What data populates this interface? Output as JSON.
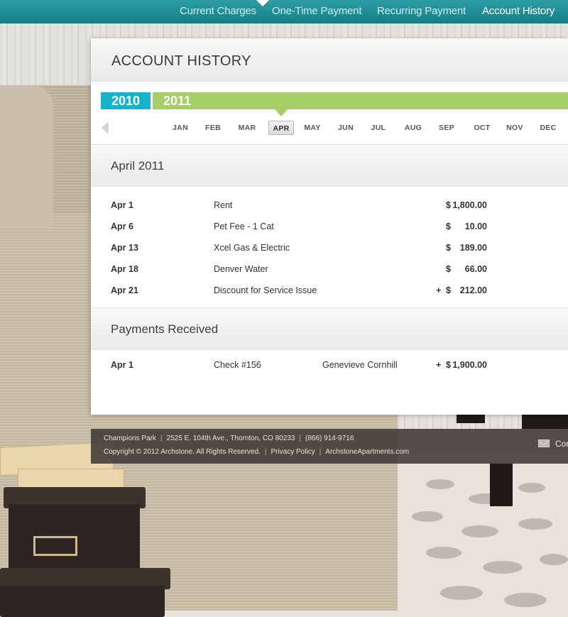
{
  "nav": {
    "items": [
      {
        "label": "Current Charges"
      },
      {
        "label": "One-Time Payment"
      },
      {
        "label": "Recurring Payment"
      },
      {
        "label": "Account History"
      }
    ],
    "active": "Account History"
  },
  "page": {
    "title": "ACCOUNT HISTORY"
  },
  "years": [
    "2010",
    "2011"
  ],
  "selected_year": "2011",
  "months": [
    "JAN",
    "FEB",
    "MAR",
    "APR",
    "MAY",
    "JUN",
    "JUL",
    "AUG",
    "SEP",
    "OCT",
    "NOV",
    "DEC"
  ],
  "selected_month": "APR",
  "charges": {
    "title": "April 2011",
    "rows": [
      {
        "date": "Apr 1",
        "description": "Rent",
        "sign": "",
        "currency": "$",
        "amount": "1,800.00"
      },
      {
        "date": "Apr 6",
        "description": "Pet Fee - 1 Cat",
        "sign": "",
        "currency": "$",
        "amount": "10.00"
      },
      {
        "date": "Apr 13",
        "description": "Xcel Gas & Electric",
        "sign": "",
        "currency": "$",
        "amount": "189.00"
      },
      {
        "date": "Apr 18",
        "description": "Denver Water",
        "sign": "",
        "currency": "$",
        "amount": "66.00"
      },
      {
        "date": "Apr 21",
        "description": "Discount for Service Issue",
        "sign": "+",
        "currency": "$",
        "amount": "212.00"
      }
    ]
  },
  "payments": {
    "title": "Payments Received",
    "rows": [
      {
        "date": "Apr 1",
        "description": "Check #156",
        "payer": "Genevieve Cornhill",
        "sign": "+",
        "currency": "$",
        "amount": "1,900.00"
      }
    ]
  },
  "footer": {
    "property": "Champions Park",
    "address": "2525 E. 104th Ave., Thornton, CO 80233",
    "phone": "(866) 914-9716",
    "copyright": "Copyright © 2012 Archstone. All Rights Reserved.",
    "privacy_link": "Privacy Policy",
    "site_link": "ArchstoneApartments.com",
    "contact_label": "Cor"
  },
  "colors": {
    "nav_teal": "#1a8a90",
    "year_2010": "#16b3cb",
    "year_2011": "#a6cf6a"
  }
}
